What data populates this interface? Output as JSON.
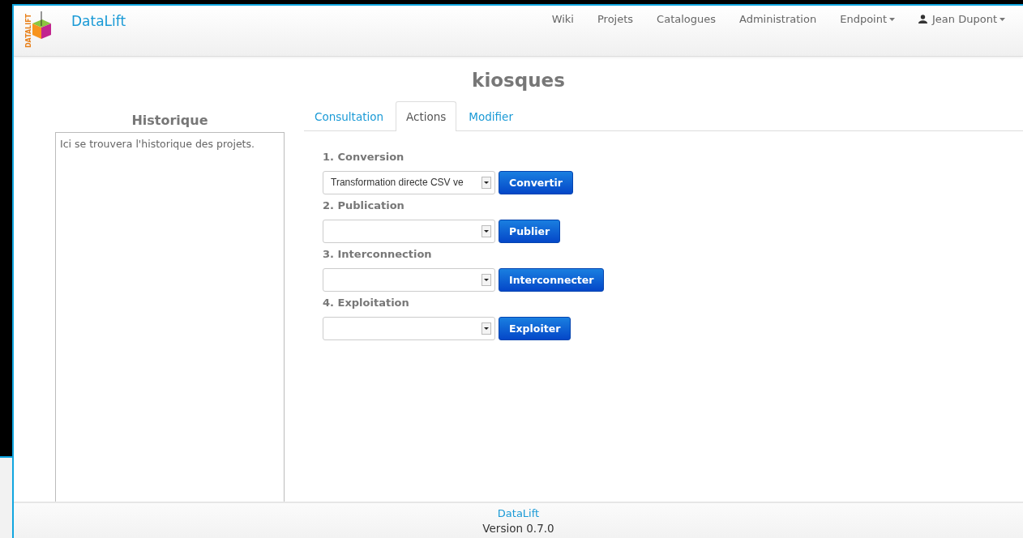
{
  "brand": {
    "name": "DataLift",
    "logo_text": "DATALIFT"
  },
  "nav": [
    {
      "label": "Wiki",
      "kind": "link"
    },
    {
      "label": "Projets",
      "kind": "link"
    },
    {
      "label": "Catalogues",
      "kind": "link"
    },
    {
      "label": "Administration",
      "kind": "link"
    },
    {
      "label": "Endpoint",
      "kind": "dropdown"
    },
    {
      "label": "Jean Dupont",
      "kind": "user"
    }
  ],
  "page_title": "kiosques",
  "history": {
    "title": "Historique",
    "text": "Ici se trouvera l'historique des projets."
  },
  "tabs": [
    {
      "label": "Consultation",
      "selected": false
    },
    {
      "label": "Actions",
      "selected": true
    },
    {
      "label": "Modifier",
      "selected": false
    }
  ],
  "steps": [
    {
      "label": "1. Conversion",
      "value": "Transformation directe CSV ve",
      "button": "Convertir"
    },
    {
      "label": "2. Publication",
      "button": "Publier"
    },
    {
      "label": "3. Interconnection",
      "button": "Interconnecter"
    },
    {
      "label": "4. Exploitation",
      "button": "Exploiter"
    }
  ],
  "footer": {
    "link": "DataLift",
    "version": "Version 0.7.0"
  }
}
